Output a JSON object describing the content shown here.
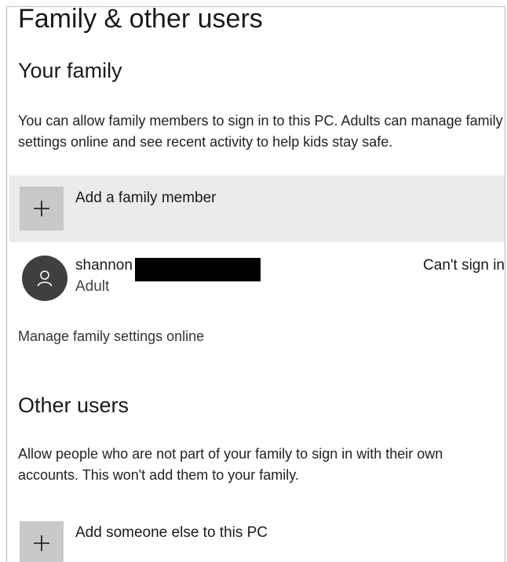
{
  "page": {
    "title": "Family & other users"
  },
  "your_family": {
    "heading": "Your family",
    "description": "You can allow family members to sign in to this PC. Adults can manage family settings online and see recent activity to help kids stay safe.",
    "add_button_label": "Add a family member",
    "add_icon": "plus-icon",
    "members": [
      {
        "name": "shannon",
        "role": "Adult",
        "status": "Can't sign in",
        "avatar_icon": "person-icon"
      }
    ],
    "manage_link": "Manage family settings online"
  },
  "other_users": {
    "heading": "Other users",
    "description": "Allow people who are not part of your family to sign in with their own accounts. This won't add them to your family.",
    "add_button_label": "Add someone else to this PC",
    "add_icon": "plus-icon"
  },
  "colors": {
    "background": "#ffffff",
    "add_row_highlight": "#ebebeb",
    "plus_tile": "#c9c9c9",
    "avatar_bg": "#3f3f3f",
    "redaction": "#000000"
  }
}
